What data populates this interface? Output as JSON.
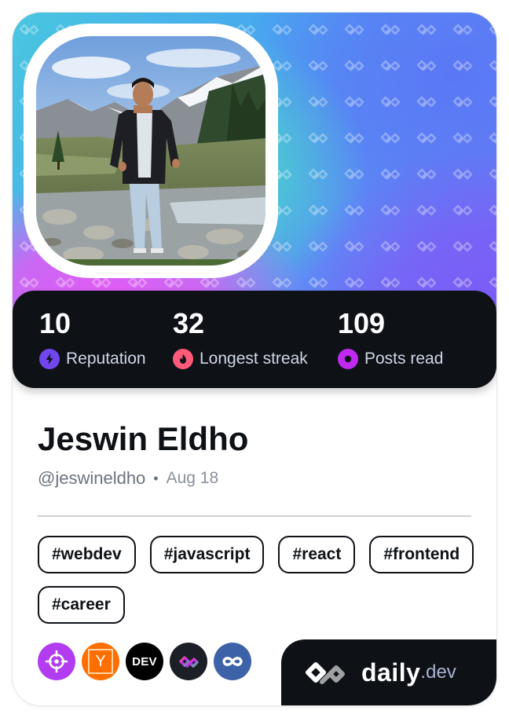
{
  "profile": {
    "name": "Jeswin Eldho",
    "handle": "@jeswineldho",
    "separator": "•",
    "date": "Aug 18"
  },
  "stats": [
    {
      "value": "10",
      "label": "Reputation",
      "icon": "reputation-bolt-icon",
      "color": "#7147ed"
    },
    {
      "value": "32",
      "label": "Longest streak",
      "icon": "streak-flame-icon",
      "color": "#ff5a7a"
    },
    {
      "value": "109",
      "label": "Posts read",
      "icon": "posts-read-eye-icon",
      "color": "#c029f0"
    }
  ],
  "tags": [
    "#webdev",
    "#javascript",
    "#react",
    "#frontend",
    "#career"
  ],
  "sources": [
    {
      "name": "crosshair-source-icon",
      "color": "#b23cf0"
    },
    {
      "name": "hacker-news-source-icon",
      "color": "#ff6f00",
      "glyph": "Y"
    },
    {
      "name": "dev-to-source-icon",
      "color": "#000000",
      "glyph": "DEV"
    },
    {
      "name": "daily-dev-community-source-icon",
      "color": "#1c1f26"
    },
    {
      "name": "infinity-source-icon",
      "color": "#3d62a8"
    }
  ],
  "brand": {
    "name": "daily",
    "tld": ".dev"
  },
  "colors": {
    "dark": "#0e1217",
    "accent_purple": "#7147ed",
    "accent_pink": "#ff5a7a",
    "accent_magenta": "#c029f0"
  }
}
